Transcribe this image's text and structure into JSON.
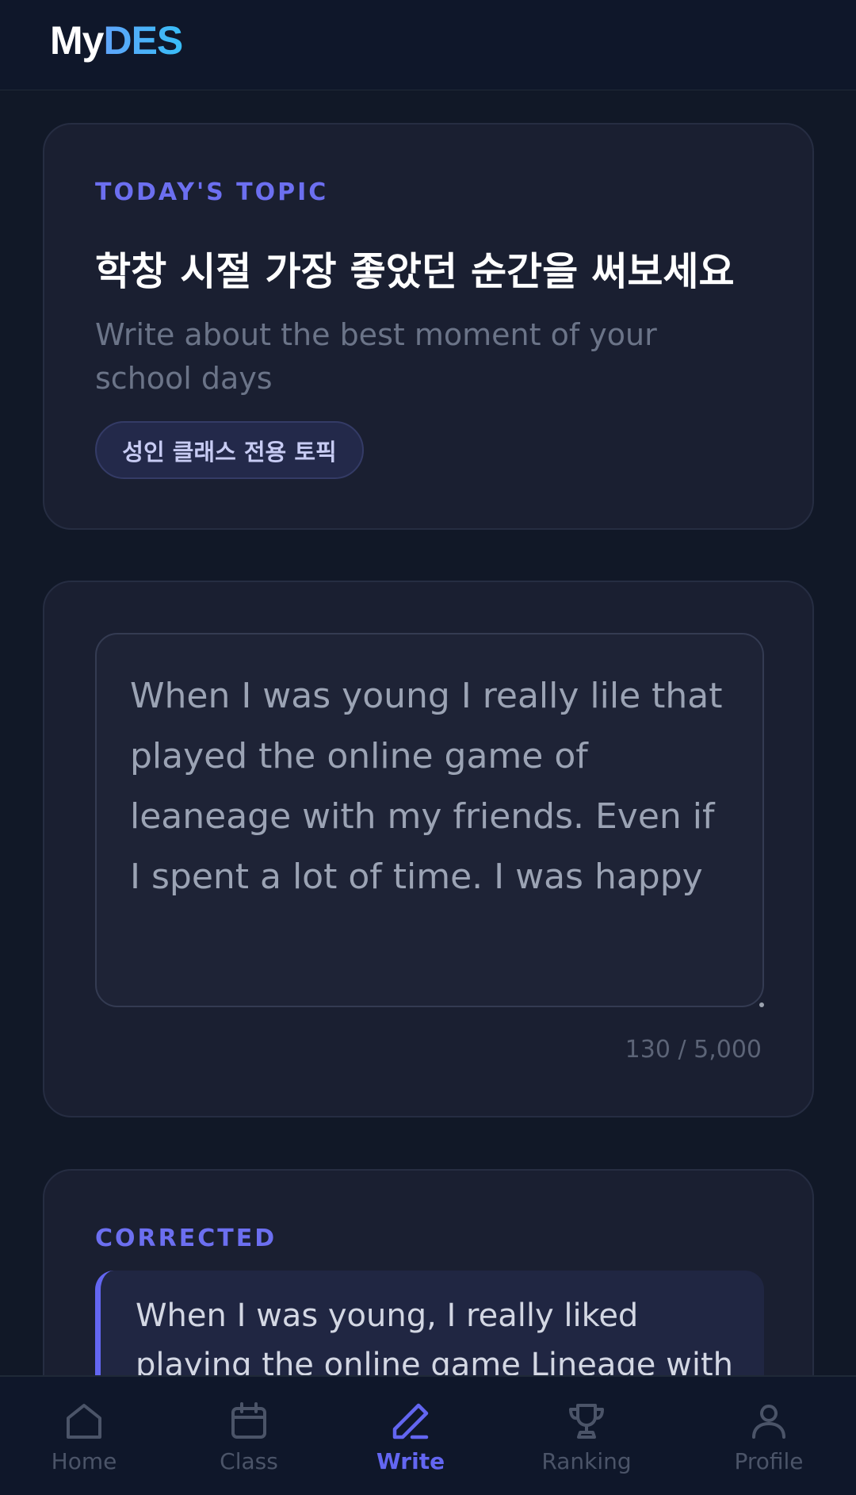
{
  "header": {
    "logo_my": "My",
    "logo_des": "DES"
  },
  "topic": {
    "eyebrow": "TODAY'S TOPIC",
    "title": "학창 시절 가장 좋았던 순간을 써보세요",
    "subtitle": "Write about the best moment of your school days",
    "chip": "성인 클래스 전용 토픽"
  },
  "editor": {
    "text": "When I was young I really lile that played the online game of leaneage with my friends. Even if I spent a lot of time. I was happy",
    "char_count": "130 / 5,000"
  },
  "corrected": {
    "eyebrow": "CORRECTED",
    "text": "When I was young, I really liked playing the online game Lineage with my"
  },
  "nav": [
    {
      "label": "Home",
      "icon": "home-icon"
    },
    {
      "label": "Class",
      "icon": "calendar-icon"
    },
    {
      "label": "Write",
      "icon": "pen-icon",
      "active": true
    },
    {
      "label": "Ranking",
      "icon": "trophy-icon"
    },
    {
      "label": "Profile",
      "icon": "user-icon"
    }
  ],
  "colors": {
    "accent": "#6366f1",
    "background": "#111827",
    "card": "#1a1f31"
  }
}
